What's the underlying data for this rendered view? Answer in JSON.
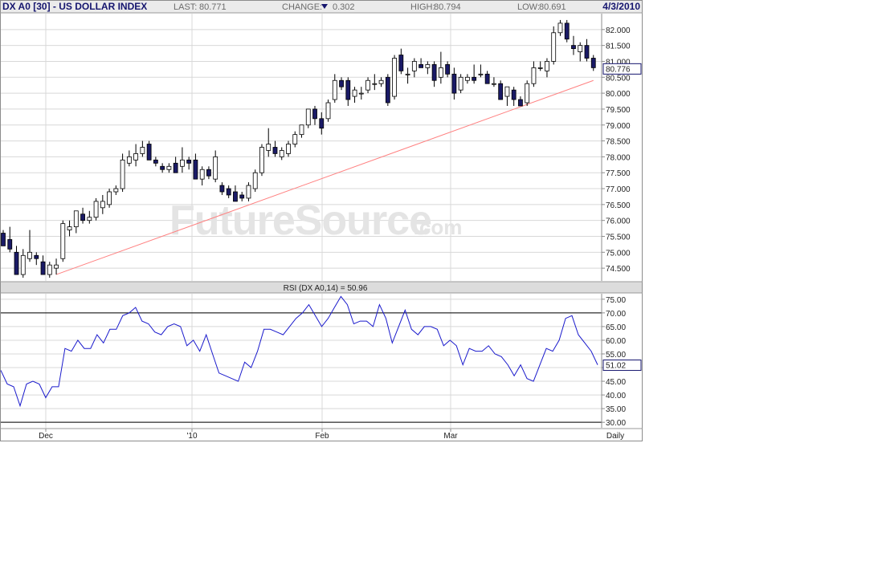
{
  "header": {
    "symbol_title": "DX A0 [30] - US DOLLAR INDEX",
    "last_label": "LAST:",
    "last_value": "80.771",
    "change_label": "CHANGE:",
    "change_value": "0.302",
    "change_direction": "down",
    "high_label": "HIGH:",
    "high_value": "80.794",
    "low_label": "LOW:",
    "low_value": "80.691",
    "date": "4/3/2010"
  },
  "watermark": {
    "main": "FutureSource",
    "suffix": ".com"
  },
  "price_panel": {
    "y_ticks": [
      "82.000",
      "81.500",
      "81.000",
      "80.500",
      "80.000",
      "79.500",
      "79.000",
      "78.500",
      "78.000",
      "77.500",
      "77.000",
      "76.500",
      "76.000",
      "75.500",
      "75.000",
      "74.500"
    ],
    "last_price_marker": "80.776"
  },
  "rsi_panel": {
    "title": "RSI (DX A0,14) = 50.96",
    "y_ticks": [
      "75.00",
      "70.00",
      "65.00",
      "60.00",
      "55.00",
      "50.00",
      "45.00",
      "40.00",
      "35.00",
      "30.00"
    ],
    "last_rsi_marker": "51.02"
  },
  "x_axis": {
    "labels": [
      "Dec",
      "'10",
      "Feb",
      "Mar"
    ],
    "period": "Daily"
  },
  "colors": {
    "title": "#15156e",
    "down_candle": "#1a1a66",
    "up_candle": "#ffffff",
    "trendline": "#ff8080",
    "rsi_line": "#1a1acc",
    "grid": "#d8d8d8",
    "panel_bar": "#dcdcdc"
  },
  "chart_data": [
    {
      "type": "candlestick",
      "title": "DX A0 [30] - US DOLLAR INDEX",
      "x_labels": [
        "Dec",
        "'10",
        "Feb",
        "Mar"
      ],
      "ylim": [
        74.1,
        82.5
      ],
      "grid": true,
      "candles": [
        {
          "o": 75.6,
          "h": 75.7,
          "l": 75.2,
          "c": 75.2
        },
        {
          "o": 75.4,
          "h": 75.8,
          "l": 75.0,
          "c": 75.1
        },
        {
          "o": 75.0,
          "h": 75.2,
          "l": 74.3,
          "c": 74.3
        },
        {
          "o": 74.3,
          "h": 75.1,
          "l": 74.2,
          "c": 74.9
        },
        {
          "o": 74.8,
          "h": 75.7,
          "l": 74.7,
          "c": 75.0
        },
        {
          "o": 74.9,
          "h": 75.0,
          "l": 74.6,
          "c": 74.8
        },
        {
          "o": 74.7,
          "h": 74.9,
          "l": 74.3,
          "c": 74.3
        },
        {
          "o": 74.3,
          "h": 74.7,
          "l": 74.2,
          "c": 74.6
        },
        {
          "o": 74.5,
          "h": 74.8,
          "l": 74.3,
          "c": 74.6
        },
        {
          "o": 74.8,
          "h": 76.0,
          "l": 74.7,
          "c": 75.9
        },
        {
          "o": 75.7,
          "h": 76.0,
          "l": 75.5,
          "c": 75.8
        },
        {
          "o": 75.8,
          "h": 76.3,
          "l": 75.6,
          "c": 76.3
        },
        {
          "o": 76.2,
          "h": 76.4,
          "l": 75.9,
          "c": 76.0
        },
        {
          "o": 76.0,
          "h": 76.3,
          "l": 75.9,
          "c": 76.1
        },
        {
          "o": 76.1,
          "h": 76.7,
          "l": 76.0,
          "c": 76.6
        },
        {
          "o": 76.4,
          "h": 76.8,
          "l": 76.2,
          "c": 76.6
        },
        {
          "o": 76.5,
          "h": 77.0,
          "l": 76.4,
          "c": 76.9
        },
        {
          "o": 76.9,
          "h": 77.1,
          "l": 76.8,
          "c": 77.0
        },
        {
          "o": 77.0,
          "h": 78.1,
          "l": 76.9,
          "c": 77.9
        },
        {
          "o": 77.8,
          "h": 78.2,
          "l": 77.7,
          "c": 78.0
        },
        {
          "o": 77.9,
          "h": 78.4,
          "l": 77.7,
          "c": 78.1
        },
        {
          "o": 78.1,
          "h": 78.5,
          "l": 78.0,
          "c": 78.3
        },
        {
          "o": 78.4,
          "h": 78.5,
          "l": 77.9,
          "c": 77.9
        },
        {
          "o": 77.9,
          "h": 78.0,
          "l": 77.7,
          "c": 77.8
        },
        {
          "o": 77.7,
          "h": 77.8,
          "l": 77.5,
          "c": 77.6
        },
        {
          "o": 77.6,
          "h": 77.8,
          "l": 77.5,
          "c": 77.7
        },
        {
          "o": 77.8,
          "h": 78.0,
          "l": 77.5,
          "c": 77.5
        },
        {
          "o": 77.7,
          "h": 78.3,
          "l": 77.5,
          "c": 77.9
        },
        {
          "o": 77.9,
          "h": 78.0,
          "l": 77.6,
          "c": 77.8
        },
        {
          "o": 77.9,
          "h": 78.1,
          "l": 77.3,
          "c": 77.3
        },
        {
          "o": 77.3,
          "h": 77.7,
          "l": 77.1,
          "c": 77.6
        },
        {
          "o": 77.6,
          "h": 77.7,
          "l": 77.3,
          "c": 77.4
        },
        {
          "o": 77.3,
          "h": 78.2,
          "l": 77.2,
          "c": 78.0
        },
        {
          "o": 77.1,
          "h": 77.2,
          "l": 76.8,
          "c": 76.9
        },
        {
          "o": 77.0,
          "h": 77.1,
          "l": 76.7,
          "c": 76.8
        },
        {
          "o": 76.9,
          "h": 77.1,
          "l": 76.6,
          "c": 76.6
        },
        {
          "o": 76.8,
          "h": 76.9,
          "l": 76.6,
          "c": 76.7
        },
        {
          "o": 76.7,
          "h": 77.2,
          "l": 76.6,
          "c": 77.1
        },
        {
          "o": 77.0,
          "h": 77.6,
          "l": 76.9,
          "c": 77.5
        },
        {
          "o": 77.5,
          "h": 78.4,
          "l": 77.4,
          "c": 78.3
        },
        {
          "o": 78.2,
          "h": 78.9,
          "l": 78.0,
          "c": 78.4
        },
        {
          "o": 78.3,
          "h": 78.5,
          "l": 78.0,
          "c": 78.1
        },
        {
          "o": 78.0,
          "h": 78.3,
          "l": 77.9,
          "c": 78.2
        },
        {
          "o": 78.1,
          "h": 78.5,
          "l": 78.0,
          "c": 78.4
        },
        {
          "o": 78.4,
          "h": 78.8,
          "l": 78.3,
          "c": 78.7
        },
        {
          "o": 78.7,
          "h": 79.0,
          "l": 78.6,
          "c": 79.0
        },
        {
          "o": 79.0,
          "h": 79.5,
          "l": 78.9,
          "c": 79.5
        },
        {
          "o": 79.5,
          "h": 79.6,
          "l": 79.0,
          "c": 79.2
        },
        {
          "o": 79.2,
          "h": 79.4,
          "l": 78.7,
          "c": 78.9
        },
        {
          "o": 79.2,
          "h": 79.8,
          "l": 79.1,
          "c": 79.7
        },
        {
          "o": 79.8,
          "h": 80.6,
          "l": 79.7,
          "c": 80.4
        },
        {
          "o": 80.4,
          "h": 80.5,
          "l": 80.1,
          "c": 80.2
        },
        {
          "o": 80.4,
          "h": 80.5,
          "l": 79.6,
          "c": 79.8
        },
        {
          "o": 79.9,
          "h": 80.2,
          "l": 79.7,
          "c": 80.1
        },
        {
          "o": 80.0,
          "h": 80.2,
          "l": 79.8,
          "c": 80.0
        },
        {
          "o": 80.1,
          "h": 80.5,
          "l": 80.0,
          "c": 80.4
        },
        {
          "o": 80.3,
          "h": 80.6,
          "l": 80.1,
          "c": 80.3
        },
        {
          "o": 80.3,
          "h": 80.5,
          "l": 80.2,
          "c": 80.4
        },
        {
          "o": 80.5,
          "h": 80.6,
          "l": 79.6,
          "c": 79.7
        },
        {
          "o": 79.9,
          "h": 81.2,
          "l": 79.8,
          "c": 81.1
        },
        {
          "o": 81.2,
          "h": 81.4,
          "l": 80.6,
          "c": 80.7
        },
        {
          "o": 80.6,
          "h": 80.8,
          "l": 80.3,
          "c": 80.6
        },
        {
          "o": 80.7,
          "h": 81.1,
          "l": 80.5,
          "c": 81.0
        },
        {
          "o": 80.9,
          "h": 81.1,
          "l": 80.8,
          "c": 80.8
        },
        {
          "o": 80.8,
          "h": 81.0,
          "l": 80.6,
          "c": 80.9
        },
        {
          "o": 80.9,
          "h": 81.0,
          "l": 80.2,
          "c": 80.4
        },
        {
          "o": 80.5,
          "h": 81.3,
          "l": 80.3,
          "c": 80.8
        },
        {
          "o": 80.9,
          "h": 81.0,
          "l": 80.5,
          "c": 80.6
        },
        {
          "o": 80.6,
          "h": 80.8,
          "l": 79.8,
          "c": 80.0
        },
        {
          "o": 80.1,
          "h": 80.6,
          "l": 80.0,
          "c": 80.5
        },
        {
          "o": 80.4,
          "h": 80.6,
          "l": 80.3,
          "c": 80.5
        },
        {
          "o": 80.5,
          "h": 80.9,
          "l": 80.3,
          "c": 80.4
        },
        {
          "o": 80.6,
          "h": 80.9,
          "l": 80.5,
          "c": 80.6
        },
        {
          "o": 80.6,
          "h": 80.7,
          "l": 80.3,
          "c": 80.3
        },
        {
          "o": 80.3,
          "h": 80.5,
          "l": 80.2,
          "c": 80.3
        },
        {
          "o": 80.3,
          "h": 80.4,
          "l": 79.8,
          "c": 79.8
        },
        {
          "o": 79.9,
          "h": 80.2,
          "l": 79.6,
          "c": 80.2
        },
        {
          "o": 80.1,
          "h": 80.2,
          "l": 79.6,
          "c": 79.8
        },
        {
          "o": 79.8,
          "h": 79.9,
          "l": 79.6,
          "c": 79.6
        },
        {
          "o": 79.7,
          "h": 80.4,
          "l": 79.6,
          "c": 80.3
        },
        {
          "o": 80.3,
          "h": 81.0,
          "l": 80.2,
          "c": 80.8
        },
        {
          "o": 80.8,
          "h": 81.0,
          "l": 80.7,
          "c": 80.8
        },
        {
          "o": 80.7,
          "h": 81.1,
          "l": 80.5,
          "c": 81.0
        },
        {
          "o": 81.0,
          "h": 82.1,
          "l": 80.9,
          "c": 81.9
        },
        {
          "o": 81.9,
          "h": 82.3,
          "l": 81.8,
          "c": 82.2
        },
        {
          "o": 82.2,
          "h": 82.3,
          "l": 81.6,
          "c": 81.7
        },
        {
          "o": 81.5,
          "h": 81.8,
          "l": 81.2,
          "c": 81.4
        },
        {
          "o": 81.3,
          "h": 81.6,
          "l": 81.0,
          "c": 81.5
        },
        {
          "o": 81.5,
          "h": 81.7,
          "l": 81.0,
          "c": 81.1
        },
        {
          "o": 81.1,
          "h": 81.2,
          "l": 80.7,
          "c": 80.8
        }
      ],
      "trendline": {
        "from": {
          "index": 8,
          "value": 74.3
        },
        "to": {
          "index": 89,
          "value": 80.4
        }
      },
      "last_marker": 80.776
    },
    {
      "type": "line",
      "title": "RSI (DX A0,14) = 50.96",
      "x_labels": [
        "Dec",
        "'10",
        "Feb",
        "Mar"
      ],
      "ylim": [
        28,
        77
      ],
      "reference_lines": [
        70,
        30
      ],
      "values": [
        49,
        44,
        43,
        36,
        44,
        45,
        44,
        39,
        43,
        43,
        57,
        56,
        60,
        57,
        57,
        62,
        59,
        64,
        64,
        69,
        70,
        72,
        67,
        66,
        63,
        62,
        65,
        66,
        65,
        58,
        60,
        56,
        62,
        55,
        48,
        47,
        46,
        45,
        52,
        50,
        56,
        64,
        64,
        63,
        62,
        65,
        68,
        70,
        73,
        69,
        65,
        68,
        72,
        76,
        73,
        66,
        67,
        67,
        65,
        73,
        68,
        59,
        65,
        71,
        64,
        62,
        65,
        65,
        64,
        58,
        60,
        58,
        51,
        57,
        56,
        56,
        58,
        55,
        54,
        51,
        47,
        51,
        46,
        45,
        51,
        57,
        56,
        60,
        68,
        69,
        62,
        59,
        56,
        51
      ],
      "last_marker": 51.02
    }
  ]
}
